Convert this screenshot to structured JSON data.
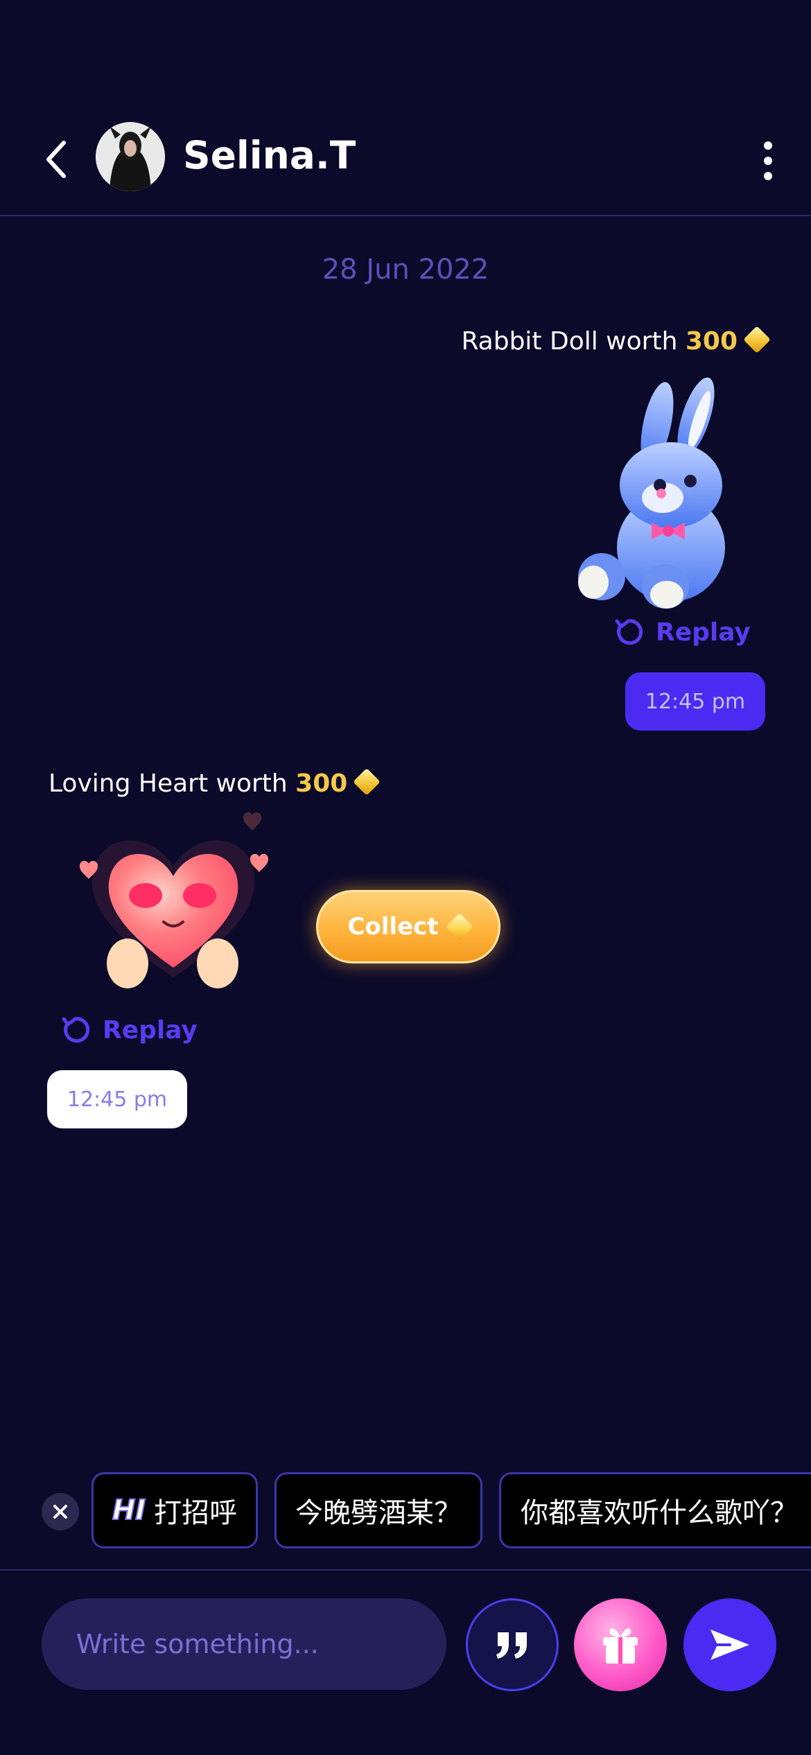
{
  "header": {
    "back_icon": "chevron-left-icon",
    "avatar_icon": "user-avatar",
    "username": "Selina.T",
    "more_icon": "more-vertical-icon"
  },
  "chat": {
    "date": "28 Jun 2022",
    "messages": [
      {
        "direction": "outgoing",
        "gift_text": "Rabbit Doll worth",
        "gift_amount": "300",
        "gift_icon": "rabbit-doll-icon",
        "replay_label": "Replay",
        "time": "12:45 pm"
      },
      {
        "direction": "incoming",
        "gift_text": "Loving Heart worth",
        "gift_amount": "300",
        "gift_icon": "loving-heart-icon",
        "replay_label": "Replay",
        "collect_label": "Collect",
        "time": "12:45 pm"
      }
    ]
  },
  "quick_replies": {
    "close_icon": "close-icon",
    "badge": "HI",
    "items": [
      "打招呼",
      "今晚劈酒某？",
      "你都喜欢听什么歌吖？"
    ]
  },
  "composer": {
    "placeholder": "Write something...",
    "quote_icon": "quote-icon",
    "gift_icon": "gift-icon",
    "send_icon": "send-icon"
  },
  "colors": {
    "background": "#0b0a2a",
    "accent": "#4b2bf2",
    "gold": "#f5c84a"
  }
}
